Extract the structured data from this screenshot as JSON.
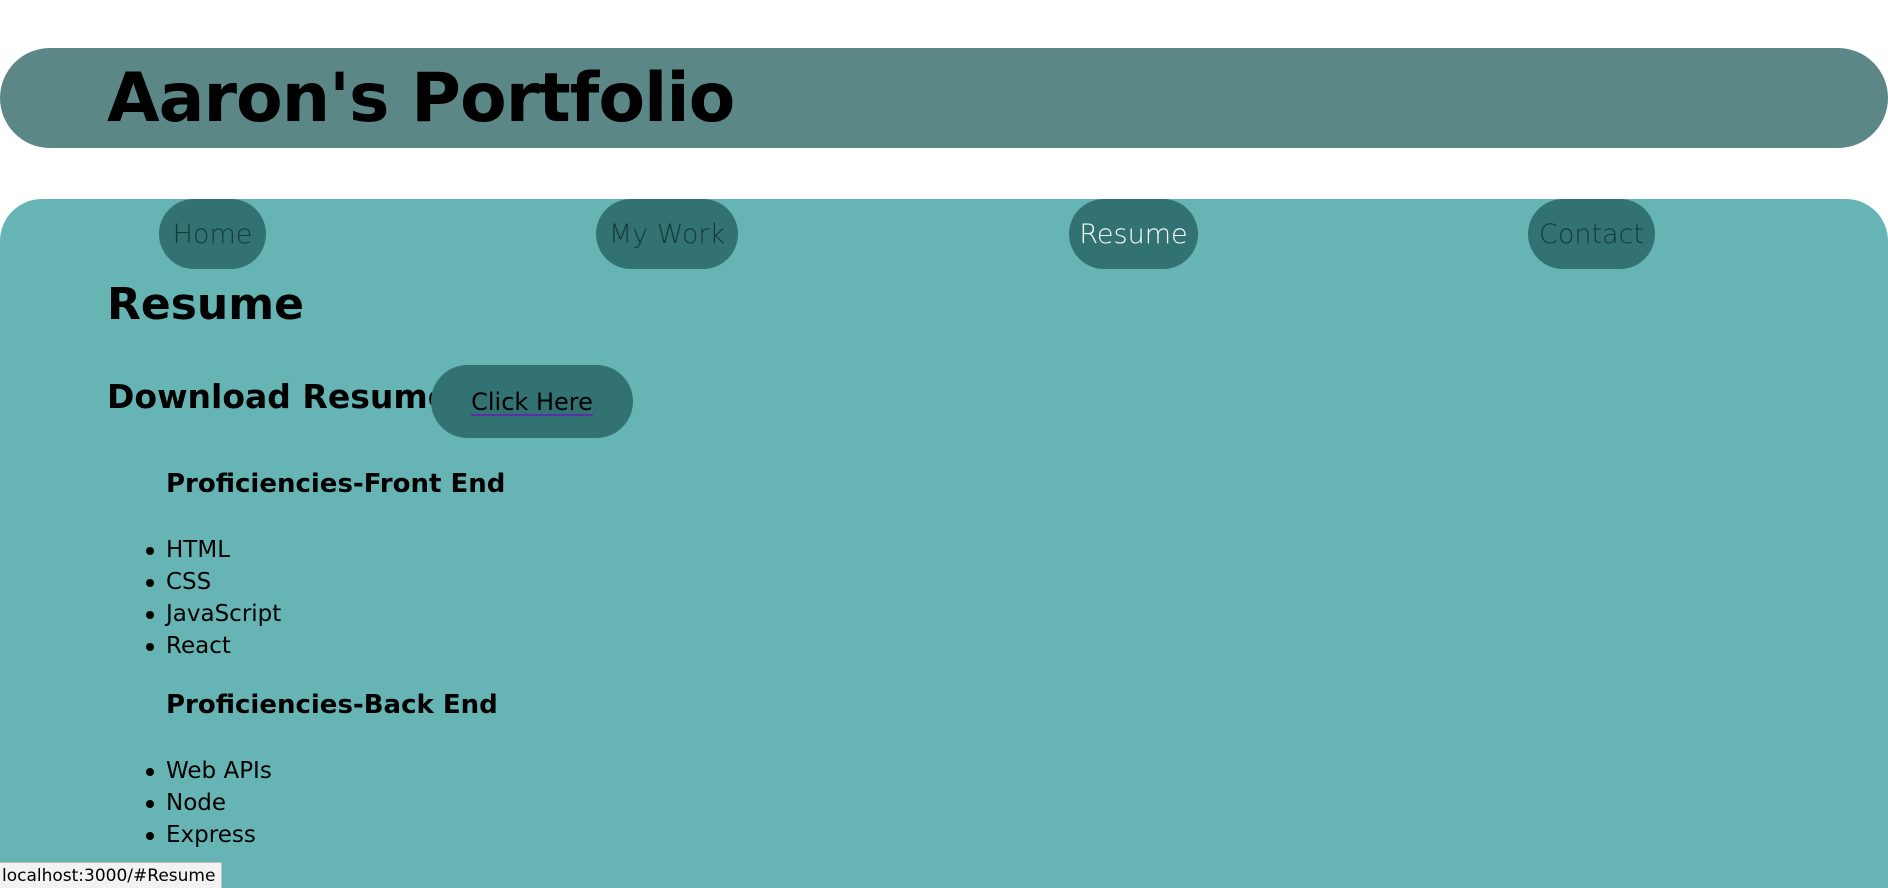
{
  "header": {
    "title": "Aaron's Portfolio"
  },
  "nav": {
    "items": [
      {
        "label": "Home",
        "active": false
      },
      {
        "label": "My Work",
        "active": false
      },
      {
        "label": "Resume",
        "active": true
      },
      {
        "label": "Contact",
        "active": false
      }
    ]
  },
  "main": {
    "title": "Resume",
    "download": {
      "label": "Download Resume",
      "button_label": "Click Here"
    },
    "sections": [
      {
        "heading": "Proficiencies-Front End",
        "items": [
          "HTML",
          "CSS",
          "JavaScript",
          "React"
        ]
      },
      {
        "heading": "Proficiencies-Back End",
        "items": [
          "Web APIs",
          "Node",
          "Express"
        ]
      }
    ]
  },
  "status_bar": {
    "url": "localhost:3000/#Resume"
  },
  "colors": {
    "header_bg": "#5b8886",
    "main_bg": "#66b4b4",
    "button_bg": "#327272"
  }
}
